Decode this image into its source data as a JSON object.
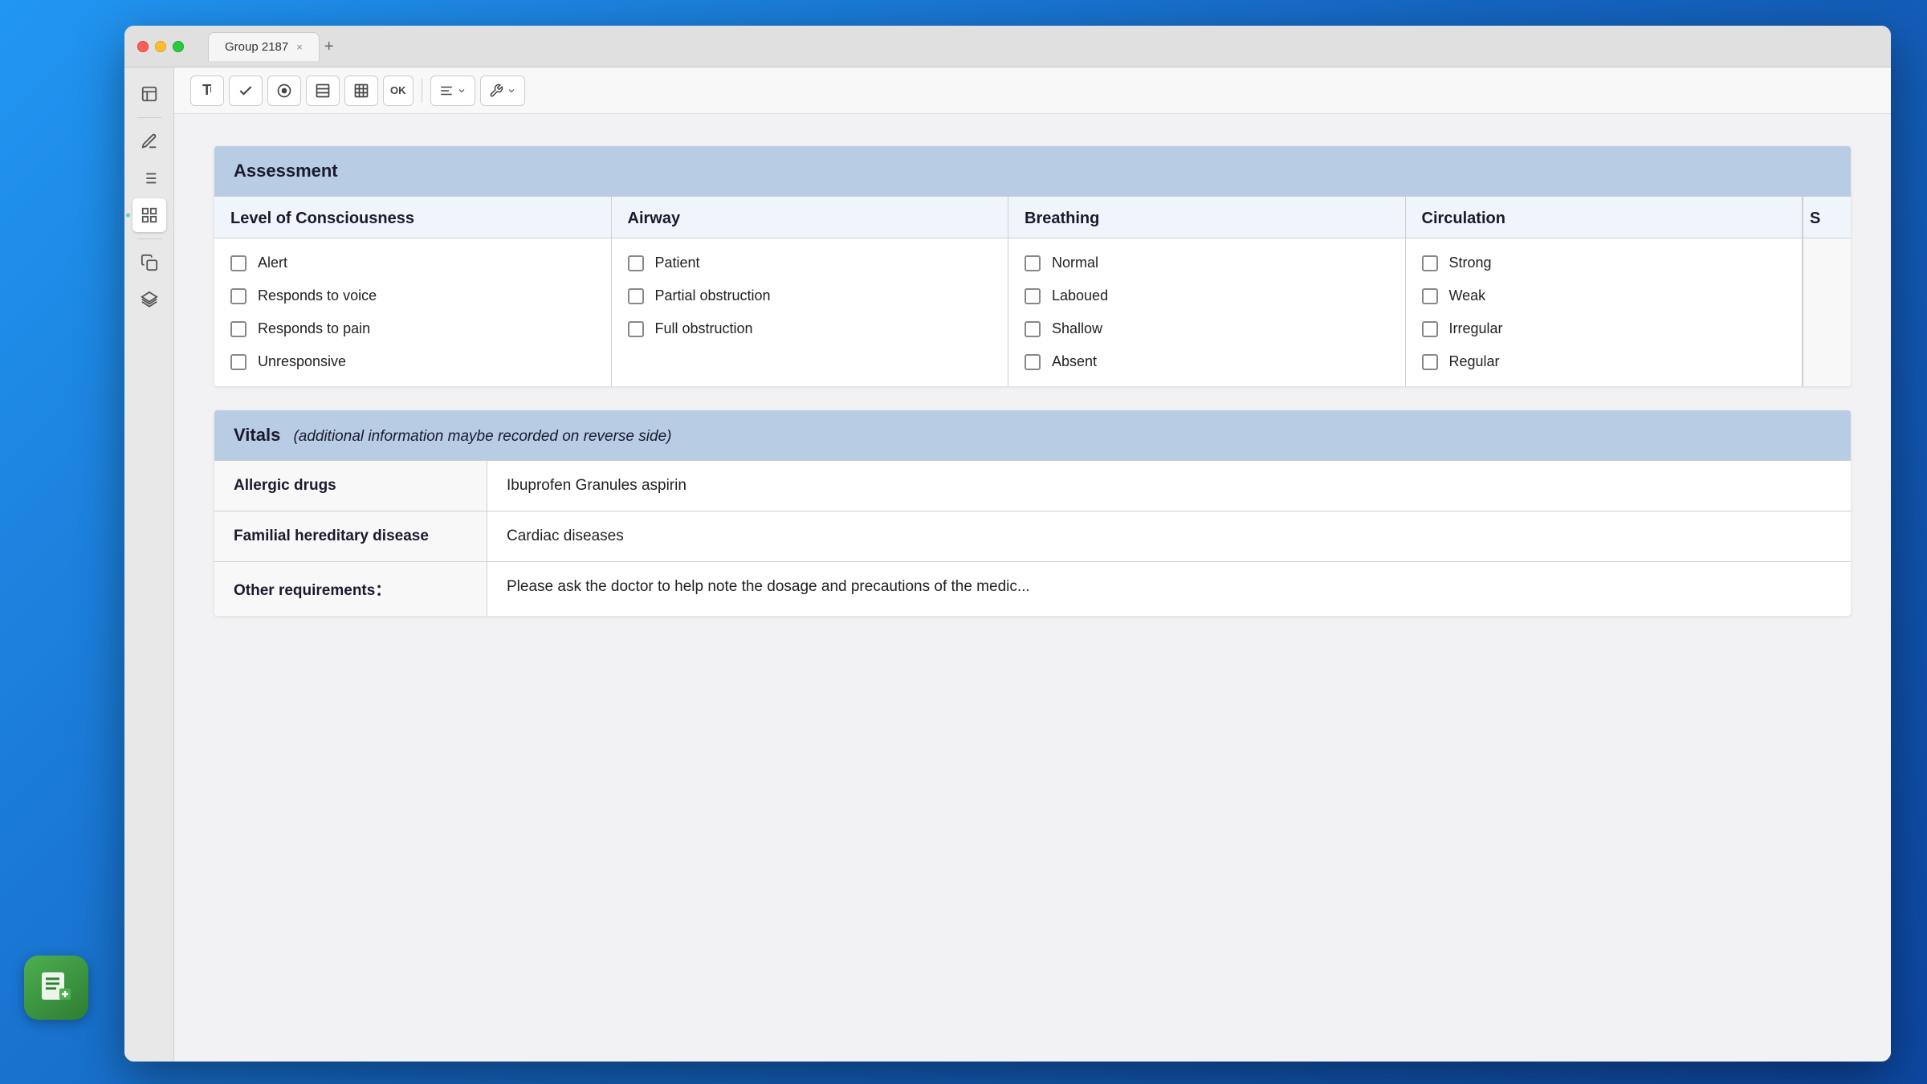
{
  "app": {
    "title": "Group 2187",
    "tab_close": "×",
    "tab_add": "+"
  },
  "toolbar": {
    "buttons": [
      {
        "id": "text",
        "icon": "T",
        "label": "text-tool"
      },
      {
        "id": "checkbox",
        "icon": "✓",
        "label": "checkbox-tool"
      },
      {
        "id": "record",
        "icon": "⏺",
        "label": "record-tool"
      },
      {
        "id": "list",
        "icon": "≡",
        "label": "list-tool"
      },
      {
        "id": "grid",
        "icon": "▦",
        "label": "grid-tool"
      },
      {
        "id": "ok",
        "icon": "OK",
        "label": "ok-button"
      }
    ],
    "dropdown1_icon": "≡",
    "dropdown2_icon": "⚙"
  },
  "sidebar": {
    "icons": [
      {
        "id": "book",
        "icon": "📋",
        "active": false
      },
      {
        "id": "pen",
        "icon": "✏",
        "active": false
      },
      {
        "id": "list",
        "icon": "☰",
        "active": false
      },
      {
        "id": "grid-active",
        "icon": "▦",
        "active": true
      },
      {
        "id": "copy",
        "icon": "❐",
        "active": false
      },
      {
        "id": "layers",
        "icon": "⧉",
        "active": false
      }
    ]
  },
  "assessment": {
    "title": "Assessment",
    "columns": [
      {
        "id": "consciousness",
        "header": "Level of Consciousness",
        "items": [
          "Alert",
          "Responds to voice",
          "Responds to pain",
          "Unresponsive"
        ]
      },
      {
        "id": "airway",
        "header": "Airway",
        "items": [
          "Patient",
          "Partial obstruction",
          "Full obstruction"
        ]
      },
      {
        "id": "breathing",
        "header": "Breathing",
        "items": [
          "Normal",
          "Laboued",
          "Shallow",
          "Absent"
        ]
      },
      {
        "id": "circulation",
        "header": "Circulation",
        "items": [
          "Strong",
          "Weak",
          "Irregular",
          "Regular"
        ]
      },
      {
        "id": "partial",
        "header": "S",
        "items": [
          "",
          "",
          "",
          ""
        ]
      }
    ]
  },
  "vitals": {
    "title": "Vitals",
    "subtitle": "(additional information maybe recorded on reverse side)",
    "rows": [
      {
        "id": "allergic",
        "label": "Allergic drugs",
        "value": "Ibuprofen Granules  aspirin"
      },
      {
        "id": "hereditary",
        "label": "Familial hereditary disease",
        "value": "Cardiac diseases"
      },
      {
        "id": "other",
        "label": "Other requirements：",
        "value": "Please ask the doctor to help note the dosage and precautions of the medic..."
      }
    ]
  }
}
